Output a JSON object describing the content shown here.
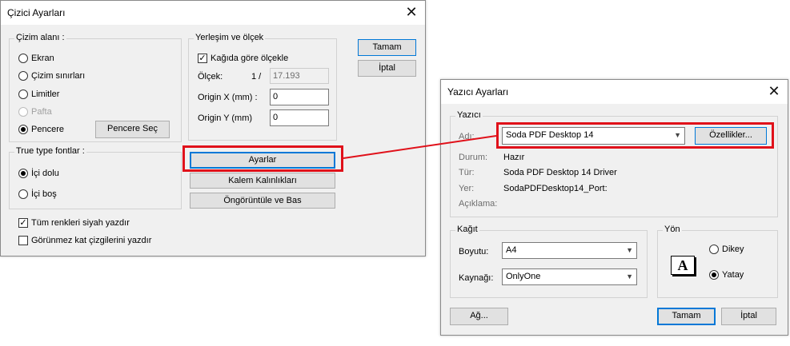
{
  "left_dialog": {
    "title": "Çizici Ayarları",
    "close_glyph": "✕",
    "drawing_area": {
      "label": "Çizim alanı :",
      "options": [
        {
          "label": "Ekran",
          "checked": false,
          "enabled": true
        },
        {
          "label": "Çizim sınırları",
          "checked": false,
          "enabled": true
        },
        {
          "label": "Limitler",
          "checked": false,
          "enabled": true
        },
        {
          "label": "Pafta",
          "checked": false,
          "enabled": false
        },
        {
          "label": "Pencere",
          "checked": true,
          "enabled": true
        }
      ],
      "select_window_button": "Pencere Seç"
    },
    "truetype": {
      "label": "True type fontlar :",
      "options": [
        {
          "label": "İçi dolu",
          "checked": true
        },
        {
          "label": "İçi boş",
          "checked": false
        }
      ]
    },
    "checks": [
      {
        "label": "Tüm renkleri siyah yazdır",
        "checked": true
      },
      {
        "label": "Görünmez kat çizgilerini yazdır",
        "checked": false
      }
    ],
    "placement": {
      "label": "Yerleşim ve ölçek",
      "fit_paper": {
        "label": "Kağıda göre ölçekle",
        "checked": true
      },
      "scale_label": "Ölçek:",
      "scale_prefix": "1 /",
      "scale_value": "17.193",
      "origin_x_label": "Origin X (mm) :",
      "origin_x_value": "0",
      "origin_y_label": "Origin Y (mm)",
      "origin_y_value": "0"
    },
    "buttons": {
      "ok": "Tamam",
      "cancel": "İptal",
      "settings": "Ayarlar",
      "pen_widths": "Kalem Kalınlıkları",
      "preview_print": "Öngörüntüle ve Bas"
    }
  },
  "right_dialog": {
    "title": "Yazıcı Ayarları",
    "close_glyph": "✕",
    "printer": {
      "group_label": "Yazıcı",
      "name_label": "Adı:",
      "name_value": "Soda PDF Desktop 14",
      "properties_button": "Özellikler...",
      "status_label": "Durum:",
      "status_value": "Hazır",
      "type_label": "Tür:",
      "type_value": "Soda PDF Desktop 14 Driver",
      "where_label": "Yer:",
      "where_value": "SodaPDFDesktop14_Port:",
      "comment_label": "Açıklama:"
    },
    "paper": {
      "group_label": "Kağıt",
      "size_label": "Boyutu:",
      "size_value": "A4",
      "source_label": "Kaynağı:",
      "source_value": "OnlyOne"
    },
    "orientation": {
      "group_label": "Yön",
      "icon_letter": "A",
      "portrait": {
        "label": "Dikey",
        "checked": false
      },
      "landscape": {
        "label": "Yatay",
        "checked": true
      }
    },
    "buttons": {
      "network": "Ağ...",
      "ok": "Tamam",
      "cancel": "İptal"
    }
  },
  "annotation_color": "#e0111a"
}
